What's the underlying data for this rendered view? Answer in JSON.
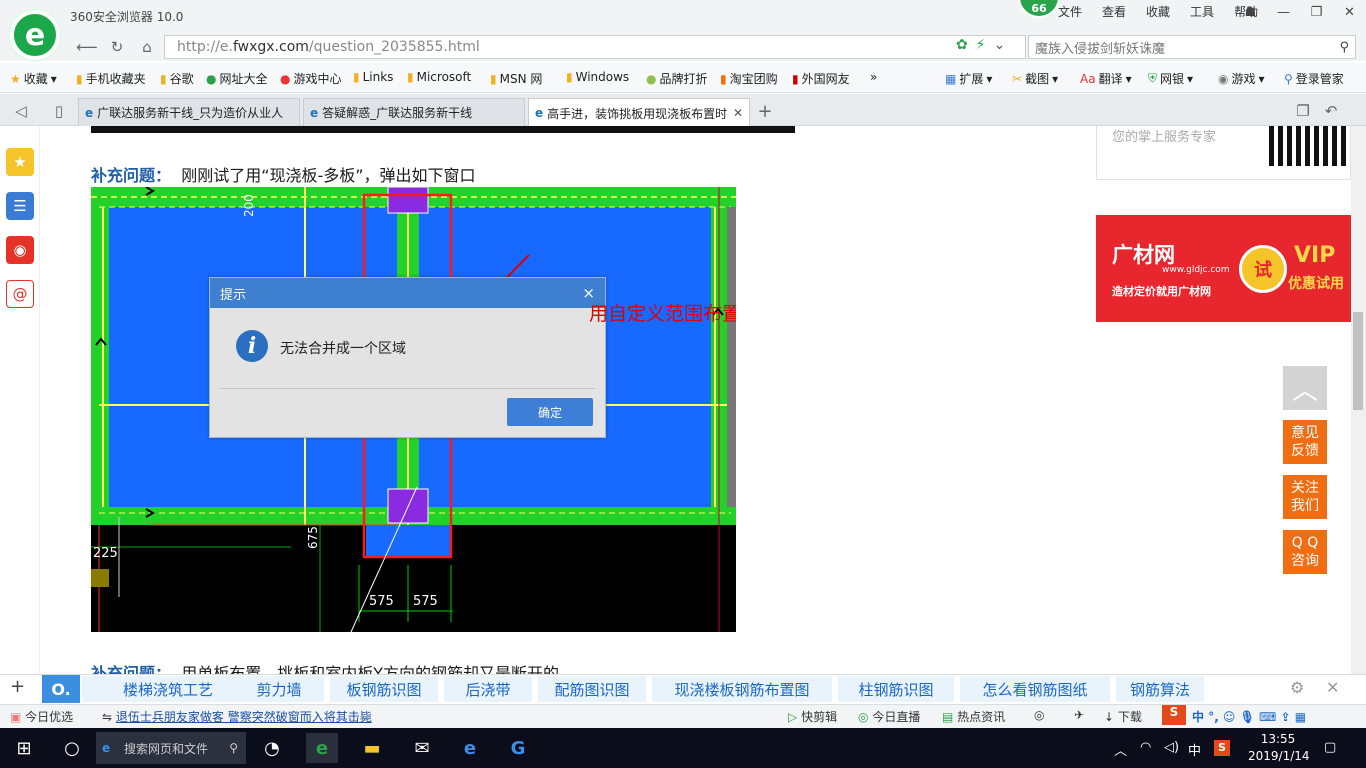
{
  "browser": {
    "title": "360安全浏览器 10.0",
    "badge": "66",
    "menus": [
      "文件",
      "查看",
      "收藏",
      "工具",
      "帮助"
    ],
    "url_prefix": "http://e.",
    "url_domain": "fwxgx.com",
    "url_path": "/question_2035855.html",
    "search_placeholder": "魔族入侵拔剑斩妖诛魔"
  },
  "bookmarks": {
    "left": [
      "收藏",
      "手机收藏夹",
      "谷歌",
      "网址大全",
      "游戏中心",
      "Links",
      "Microsoft",
      "MSN 网",
      "Windows",
      "品牌打折",
      "淘宝团购",
      "外国网友"
    ],
    "right": [
      "扩展",
      "截图",
      "翻译",
      "网银",
      "游戏",
      "登录管家"
    ]
  },
  "tabs": [
    {
      "label": "广联达服务新干线_只为造价从业人"
    },
    {
      "label": "答疑解惑_广联达服务新干线"
    },
    {
      "label": "高手进，装饰挑板用现浇板布置时"
    }
  ],
  "content": {
    "supp_label": "补充问题：",
    "supp1_text": "刚刚试了用“现浇板-多板”，弹出如下窗口",
    "supp2_text": "用单板布置，挑板和室内板Y方向的钢筋却又是断开的",
    "annotation": "用自定义范围布置悬挑出来的板钢筋",
    "cad_dims": [
      "200",
      "225",
      "675",
      "575",
      "575"
    ],
    "dialog": {
      "title": "提示",
      "message": "无法合并成一个区域",
      "ok": "确定",
      "close": "×"
    },
    "rad1_text": "您的掌上服务专家",
    "ad": {
      "logo": "广材网",
      "url": "www.gldjc.com",
      "slogan": "造材定价就用广材网",
      "trial": "试",
      "vip": "VIP",
      "vip2": "优惠试用"
    },
    "float": [
      "意见\n反馈",
      "关注\n我们",
      "Q Q\n咨询"
    ]
  },
  "hotwords": [
    "楼梯浇筑工艺",
    "剪力墙",
    "板钢筋识图",
    "后浇带",
    "配筋图识图",
    "现浇楼板钢筋布置图",
    "柱钢筋识图",
    "怎么看钢筋图纸",
    "钢筋算法"
  ],
  "status": {
    "today": "今日优选",
    "news": "退伍士兵朋友家做客 警察突然破窗而入将其击毙",
    "items": [
      "快剪辑",
      "今日直播",
      "热点资讯",
      "下载"
    ],
    "ime": "中"
  },
  "taskbar": {
    "search_placeholder": "搜索网页和文件",
    "time": "13:55",
    "date": "2019/1/14",
    "lang": "中"
  },
  "colors": {
    "accent": "#1aa84a",
    "link": "#1f5fa8",
    "cad_blue": "#1769ff",
    "cad_green": "#22d12a",
    "highlight": "#e10000",
    "orange": "#f06d12"
  }
}
